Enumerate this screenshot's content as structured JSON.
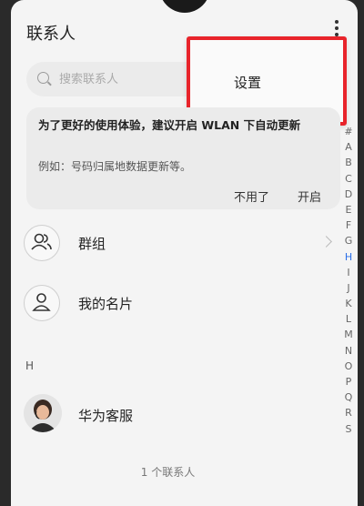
{
  "header": {
    "title": "联系人"
  },
  "search": {
    "placeholder": "搜索联系人"
  },
  "popup_menu": {
    "settings_label": "设置",
    "highlight_color": "#e8242b"
  },
  "wlan_banner": {
    "title": "为了更好的使用体验，建议开启 WLAN 下自动更新",
    "subtitle": "例如：号码归属地数据更新等。",
    "dismiss_label": "不用了",
    "enable_label": "开启"
  },
  "quick_items": [
    {
      "label": "群组",
      "icon": "group-icon"
    },
    {
      "label": "我的名片",
      "icon": "person-icon"
    }
  ],
  "sections": [
    {
      "header": "H",
      "contacts": [
        {
          "name": "华为客服",
          "avatar": "avatar-photo"
        }
      ]
    }
  ],
  "footer": {
    "count_text": "1 个联系人"
  },
  "alpha_index": [
    "#",
    "A",
    "B",
    "C",
    "D",
    "E",
    "F",
    "G",
    "H",
    "I",
    "J",
    "K",
    "L",
    "M",
    "N",
    "O",
    "P",
    "Q",
    "R",
    "S"
  ],
  "colors": {
    "accent": "#2a6ee8",
    "background": "#f4f4f4"
  }
}
